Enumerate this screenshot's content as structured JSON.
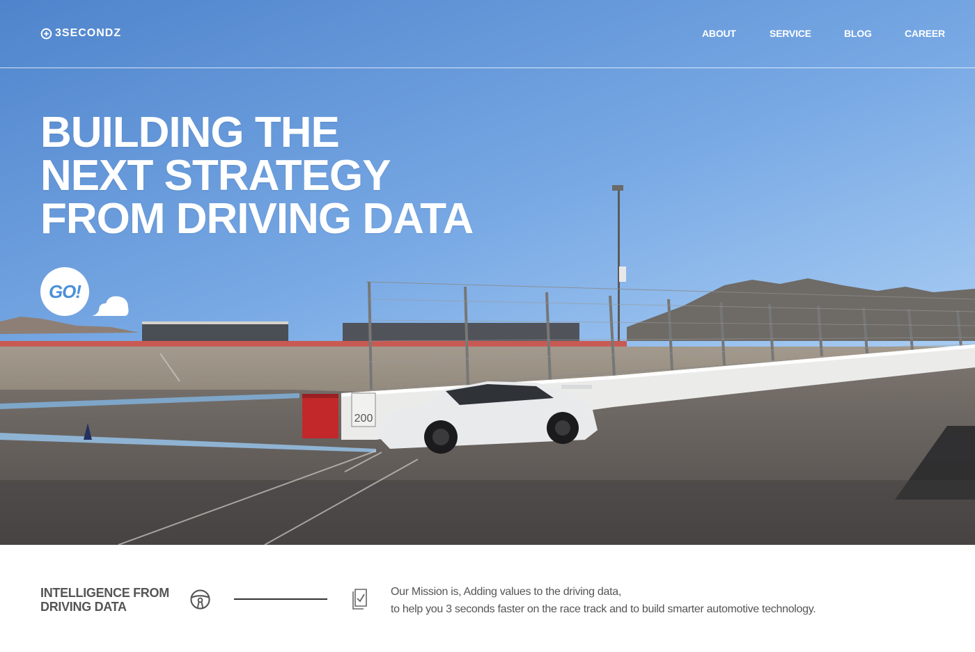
{
  "header": {
    "logo_text": "3SECONDZ",
    "nav": [
      {
        "label": "ABOUT"
      },
      {
        "label": "SERVICE"
      },
      {
        "label": "BLOG"
      },
      {
        "label": "CAREER"
      }
    ]
  },
  "hero": {
    "headline_lines": [
      "BUILDING THE",
      "NEXT STRATEGY",
      "FROM DRIVING DATA"
    ],
    "go_label": "GO!",
    "sign_speed": "200"
  },
  "strip": {
    "title_lines": [
      "INTELLIGENCE FROM",
      "DRIVING DATA"
    ],
    "mission_lines": [
      "Our Mission is, Adding values to the driving data,",
      "to help you 3 seconds faster on the race track and to build smarter automotive technology."
    ]
  },
  "icons": {
    "logo": "logo-mark-icon",
    "cloud": "cloud-icon",
    "steering": "steering-wheel-icon",
    "document": "document-check-icon"
  },
  "colors": {
    "sky_top": "#5d8fd2",
    "sky_bottom": "#b9d4ee",
    "accent_blue": "#4a90d9",
    "text_dark": "#555555",
    "white": "#ffffff"
  }
}
